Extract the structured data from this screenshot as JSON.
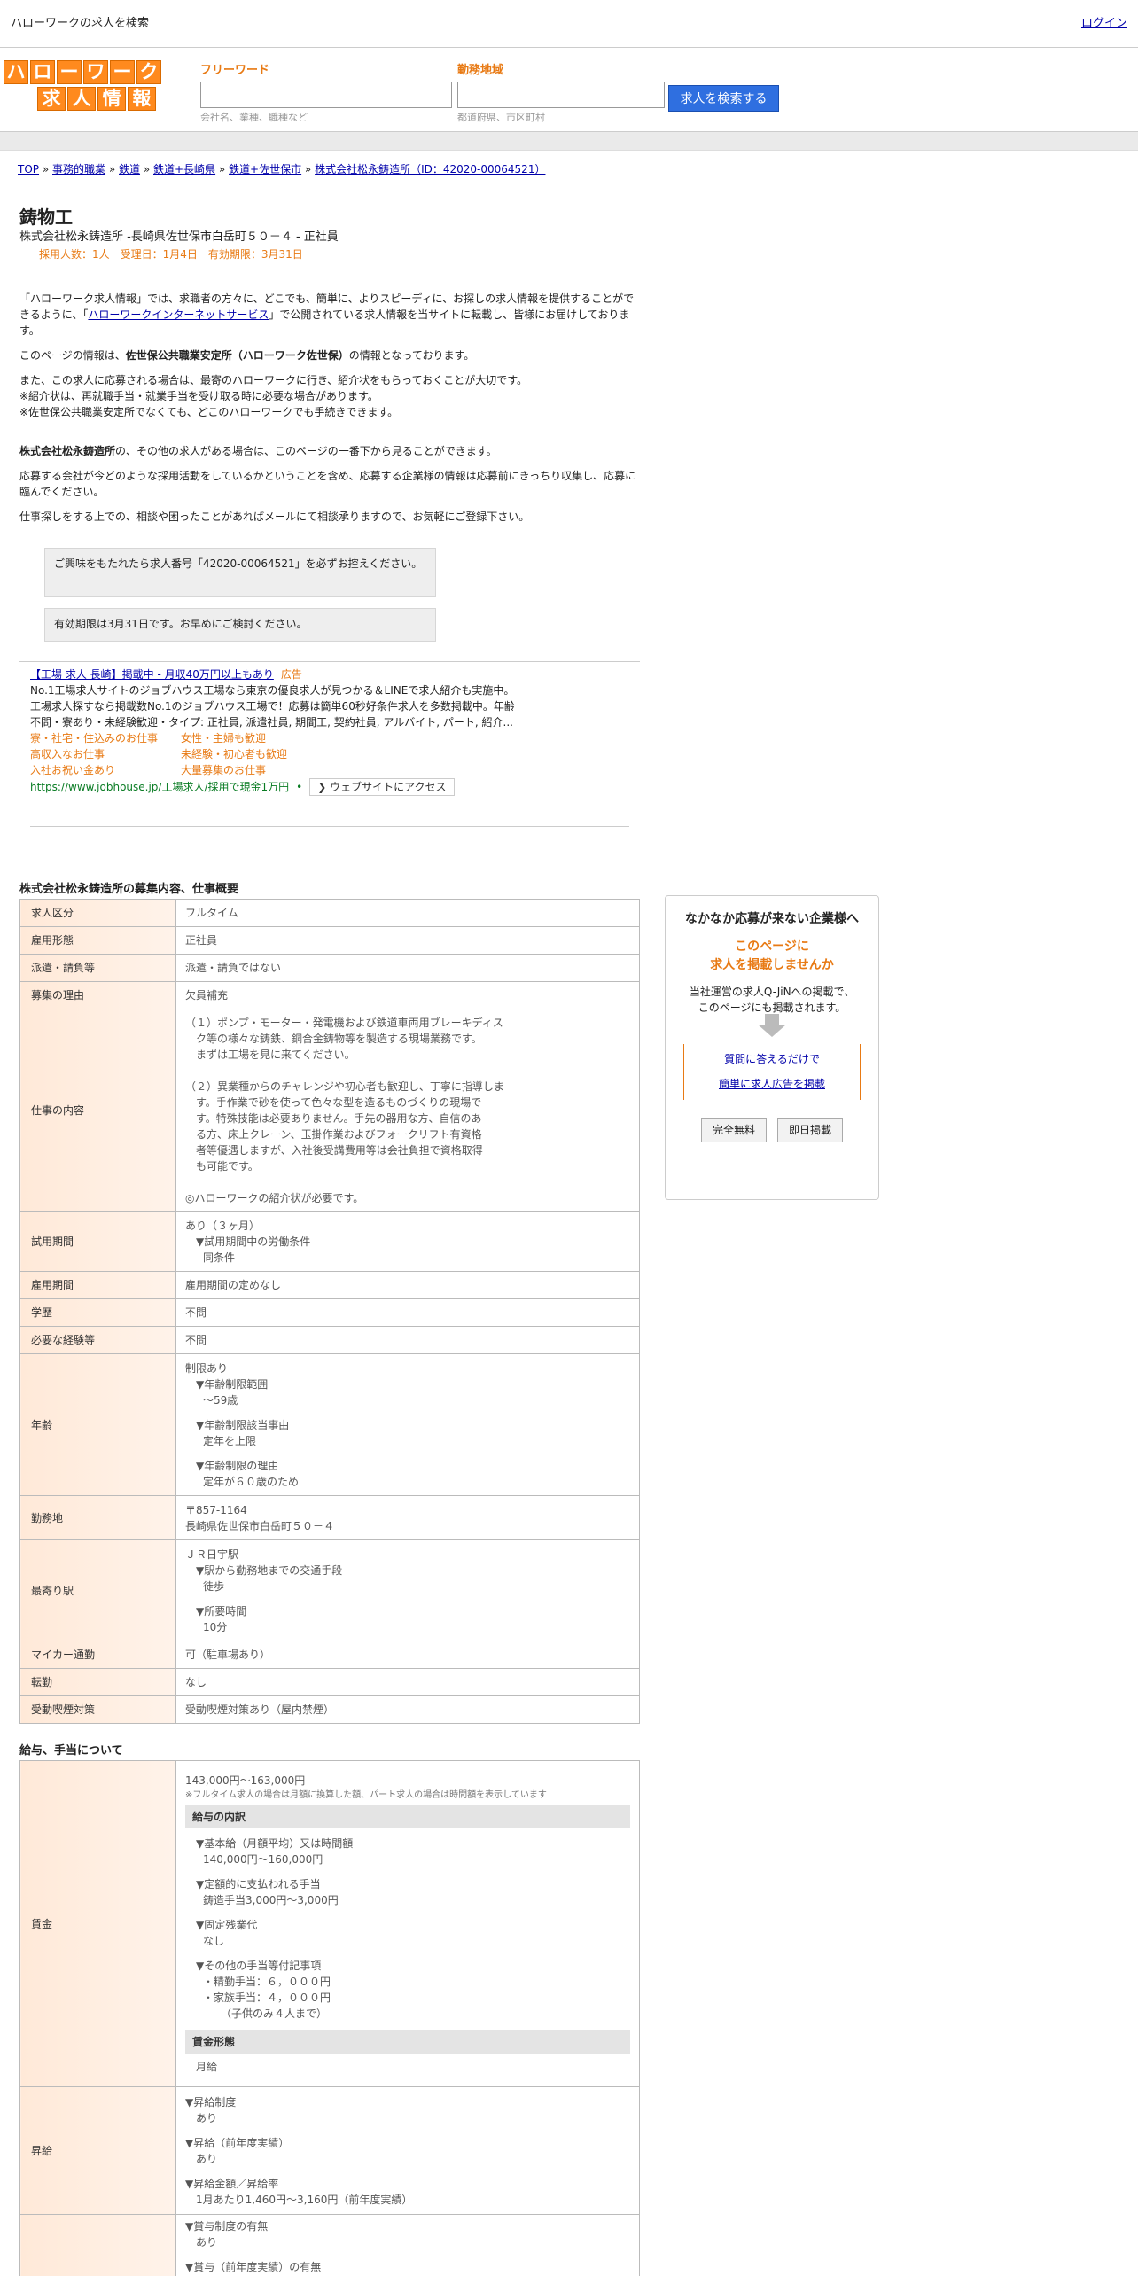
{
  "top": {
    "site_title": "ハローワークの求人を検索",
    "login": "ログイン"
  },
  "logo": {
    "row1": [
      "ハ",
      "ロ",
      "ー",
      "ワ",
      "ー",
      "ク"
    ],
    "row2": [
      "求",
      "人",
      "情",
      "報"
    ]
  },
  "search": {
    "free_label": "フリーワード",
    "free_hint": "会社名、業種、職種など",
    "area_label": "勤務地域",
    "area_hint": "都道府県、市区町村",
    "button": "求人を検索する"
  },
  "breadcrumb": {
    "items": [
      "TOP",
      "事務的職業",
      "鉄道",
      "鉄道+長崎県",
      "鉄道+佐世保市",
      "株式会社松永鋳造所（ID：42020-00064521）"
    ],
    "sep": " » "
  },
  "job": {
    "title": "鋳物工",
    "subtitle": "株式会社松永鋳造所 -長崎県佐世保市白岳町５０－４ - 正社員",
    "meta": "採用人数：1人　受理日：1月4日　有効期限：3月31日"
  },
  "intro": {
    "p1a": "「ハローワーク求人情報」では、求職者の方々に、どこでも、簡単に、よりスピーディに、お探しの求人情報を提供することができるように、「",
    "p1link": "ハローワークインターネットサービス",
    "p1b": "」で公開されている求人情報を当サイトに転載し、皆様にお届けしております。",
    "p2a": "このページの情報は、",
    "p2b": "佐世保公共職業安定所（ハローワーク佐世保）",
    "p2c": "の情報となっております。",
    "p3l1": "また、この求人に応募される場合は、最寄のハローワークに行き、紹介状をもらっておくことが大切です。",
    "p3l2": "※紹介状は、再就職手当・就業手当を受け取る時に必要な場合があります。",
    "p3l3": "※佐世保公共職業安定所でなくても、どこのハローワークでも手続きできます。",
    "p4a": "株式会社松永鋳造所",
    "p4b": "の、その他の求人がある場合は、このページの一番下から見ることができます。",
    "p5": "応募する会社が今どのような採用活動をしているかということを含め、応募する企業様の情報は応募前にきっちり収集し、応募に臨んでください。",
    "p6": "仕事探しをする上での、相談や困ったことがあればメールにて相談承りますので、お気軽にご登録下さい。"
  },
  "notices": {
    "n1": "ご興味をもたれたら求人番号「42020-00064521」を必ずお控えください。",
    "n2": "有効期限は3月31日です。お早めにご検討ください。"
  },
  "ad": {
    "title": "【工場 求人 長崎】掲載中 - 月収40万円以上もあり",
    "tag": "広告",
    "l1": "No.1工場求人サイトのジョブハウス工場なら東京の優良求人が見つかる＆LINEで求人紹介も実施中。",
    "l2": "工場求人探すなら掲載数No.1のジョブハウス工場で！応募は簡単60秒好条件求人を多数掲載中。年齢",
    "l3": "不問・寮あり・未経験歓迎・タイプ: 正社員, 派遣社員, 期間工, 契約社員, アルバイト, パート, 紹介...",
    "links": [
      "寮・社宅・住込みのお仕事",
      "女性・主婦も歓迎",
      "高収入なお仕事",
      "未経験・初心者も歓迎",
      "入社お祝い金あり",
      "大量募集のお仕事"
    ],
    "url": "https://www.jobhouse.jp/工場求人/採用で現金1万円",
    "visit": "ウェブサイトにアクセス"
  },
  "section1": "株式会社松永鋳造所の募集内容、仕事概要",
  "rows": {
    "r1": {
      "k": "求人区分",
      "v": "フルタイム"
    },
    "r2": {
      "k": "雇用形態",
      "v": "正社員"
    },
    "r3": {
      "k": "派遣・請負等",
      "v": "派遣・請負ではない"
    },
    "r4": {
      "k": "募集の理由",
      "v": "欠員補充"
    },
    "r5": {
      "k": "仕事の内容",
      "a1": "（１）ポンプ・モーター・発電機および鉄道車両用ブレーキディス",
      "a2": "ク等の様々な鋳鉄、銅合金鋳物等を製造する現場業務です。",
      "a3": "まずは工場を見に来てください。",
      "b1": "（２）異業種からのチャレンジや初心者も歓迎し、丁寧に指導しま",
      "b2": "す。手作業で砂を使って色々な型を造るものづくりの現場で",
      "b3": "す。特殊技能は必要ありません。手先の器用な方、自信のあ",
      "b4": "る方、床上クレーン、玉掛作業およびフォークリフト有資格",
      "b5": "者等優遇しますが、入社後受講費用等は会社負担で資格取得",
      "b6": "も可能です。",
      "c1": "◎ハローワークの紹介状が必要です。"
    },
    "r6": {
      "k": "試用期間",
      "v1": "あり（３ヶ月）",
      "v2": "▼試用期間中の労働条件",
      "v3": "同条件"
    },
    "r7": {
      "k": "雇用期間",
      "v": "雇用期間の定めなし"
    },
    "r8": {
      "k": "学歴",
      "v": "不問"
    },
    "r9": {
      "k": "必要な経験等",
      "v": "不問"
    },
    "r10": {
      "k": "年齢",
      "v1": "制限あり",
      "v2": "▼年齢制限範囲",
      "v3": "〜59歳",
      "v4": "▼年齢制限該当事由",
      "v5": "定年を上限",
      "v6": "▼年齢制限の理由",
      "v7": "定年が６０歳のため"
    },
    "r11": {
      "k": "勤務地",
      "v1": "〒857-1164",
      "v2": "長崎県佐世保市白岳町５０－４"
    },
    "r12": {
      "k": "最寄り駅",
      "v1": "ＪＲ日宇駅",
      "v2": "▼駅から勤務地までの交通手段",
      "v3": "徒歩",
      "v4": "▼所要時間",
      "v5": "10分"
    },
    "r13": {
      "k": "マイカー通勤",
      "v": "可（駐車場あり）"
    },
    "r14": {
      "k": "転勤",
      "v": "なし"
    },
    "r15": {
      "k": "受動喫煙対策",
      "v": "受動喫煙対策あり（屋内禁煙）"
    }
  },
  "section2": "給与、手当について",
  "pay": {
    "k1": "賃金",
    "amount": "143,000円〜163,000円",
    "note": "※フルタイム求人の場合は月額に換算した額、パート求人の場合は時間額を表示しています",
    "breakdown": "給与の内訳",
    "b1": "▼基本給（月額平均）又は時間額",
    "b2": "140,000円〜160,000円",
    "b3": "▼定額的に支払われる手当",
    "b4": "鋳造手当3,000円〜3,000円",
    "b5": "▼固定残業代",
    "b6": "なし",
    "b7": "▼その他の手当等付記事項",
    "b8": "・精勤手当：６，０００円",
    "b9": "・家族手当：４，０００円",
    "b10": "（子供のみ４人まで）",
    "form": "賃金形態",
    "form_v": "月給",
    "k2": "昇給",
    "c1": "▼昇給制度",
    "c2": "あり",
    "c3": "▼昇給（前年度実績）",
    "c4": "あり",
    "c5": "▼昇給金額／昇給率",
    "c6": "1月あたり1,460円〜3,160円（前年度実績）",
    "d1": "▼賞与制度の有無",
    "d2": "あり",
    "d3": "▼賞与（前年度実績）の有無"
  },
  "side": {
    "head": "なかなか応募が来ない企業様へ",
    "o1": "このページに",
    "o2": "求人を掲載しませんか",
    "d1": "当社運営の求人Q-JiNへの掲載で、",
    "d2": "このページにも掲載されます。",
    "l1": "質問に答えるだけで",
    "l2": "簡単に求人広告を掲載",
    "b1": "完全無料",
    "b2": "即日掲載"
  }
}
